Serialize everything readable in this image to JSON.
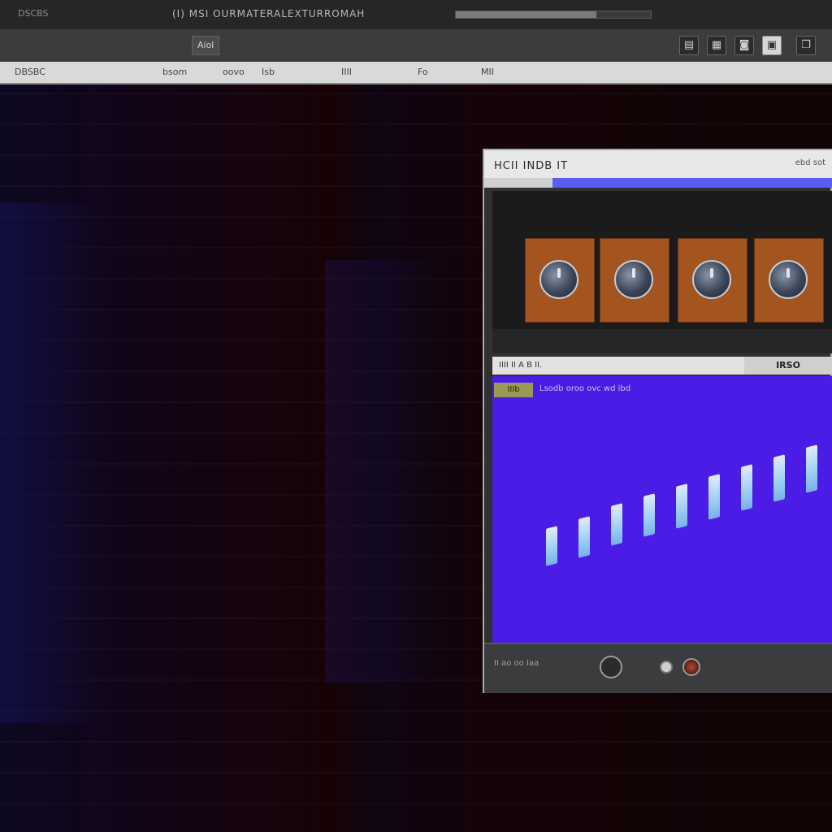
{
  "titlebar": {
    "app_label": "DSCBS",
    "doc_title": "(I) MSI OURMATERALEXTURROMAH",
    "progress_fraction": 0.72
  },
  "toolbar": {
    "left_button": "Aiol",
    "icons": [
      "panel-icon",
      "grid-icon",
      "camera-icon",
      "record-icon",
      "window-icon"
    ]
  },
  "addressbar": {
    "label": "DBSBC",
    "fields": [
      "bsom",
      "oovo",
      "Isb",
      "IIII",
      "Fo",
      "MII"
    ]
  },
  "window": {
    "title": "HCII INDB IT",
    "meta": "ebd sot",
    "tiles": [
      "knob-1",
      "knob-2",
      "knob-3",
      "knob-4"
    ],
    "mid_left": "IIII  II  A  B II.",
    "mid_right": "IRSO",
    "viz_tag": "IIIb",
    "viz_caption": "Lsodb oroo ovc wd ibd",
    "bar_levels": [
      0.32,
      0.38,
      0.46,
      0.52,
      0.58,
      0.64,
      0.7,
      0.76,
      0.82
    ],
    "status": "II ao oo Iaa"
  },
  "colors": {
    "accent": "#5d5cf2",
    "viz_background": "#4a1ce6",
    "tile": "#a4541f"
  }
}
